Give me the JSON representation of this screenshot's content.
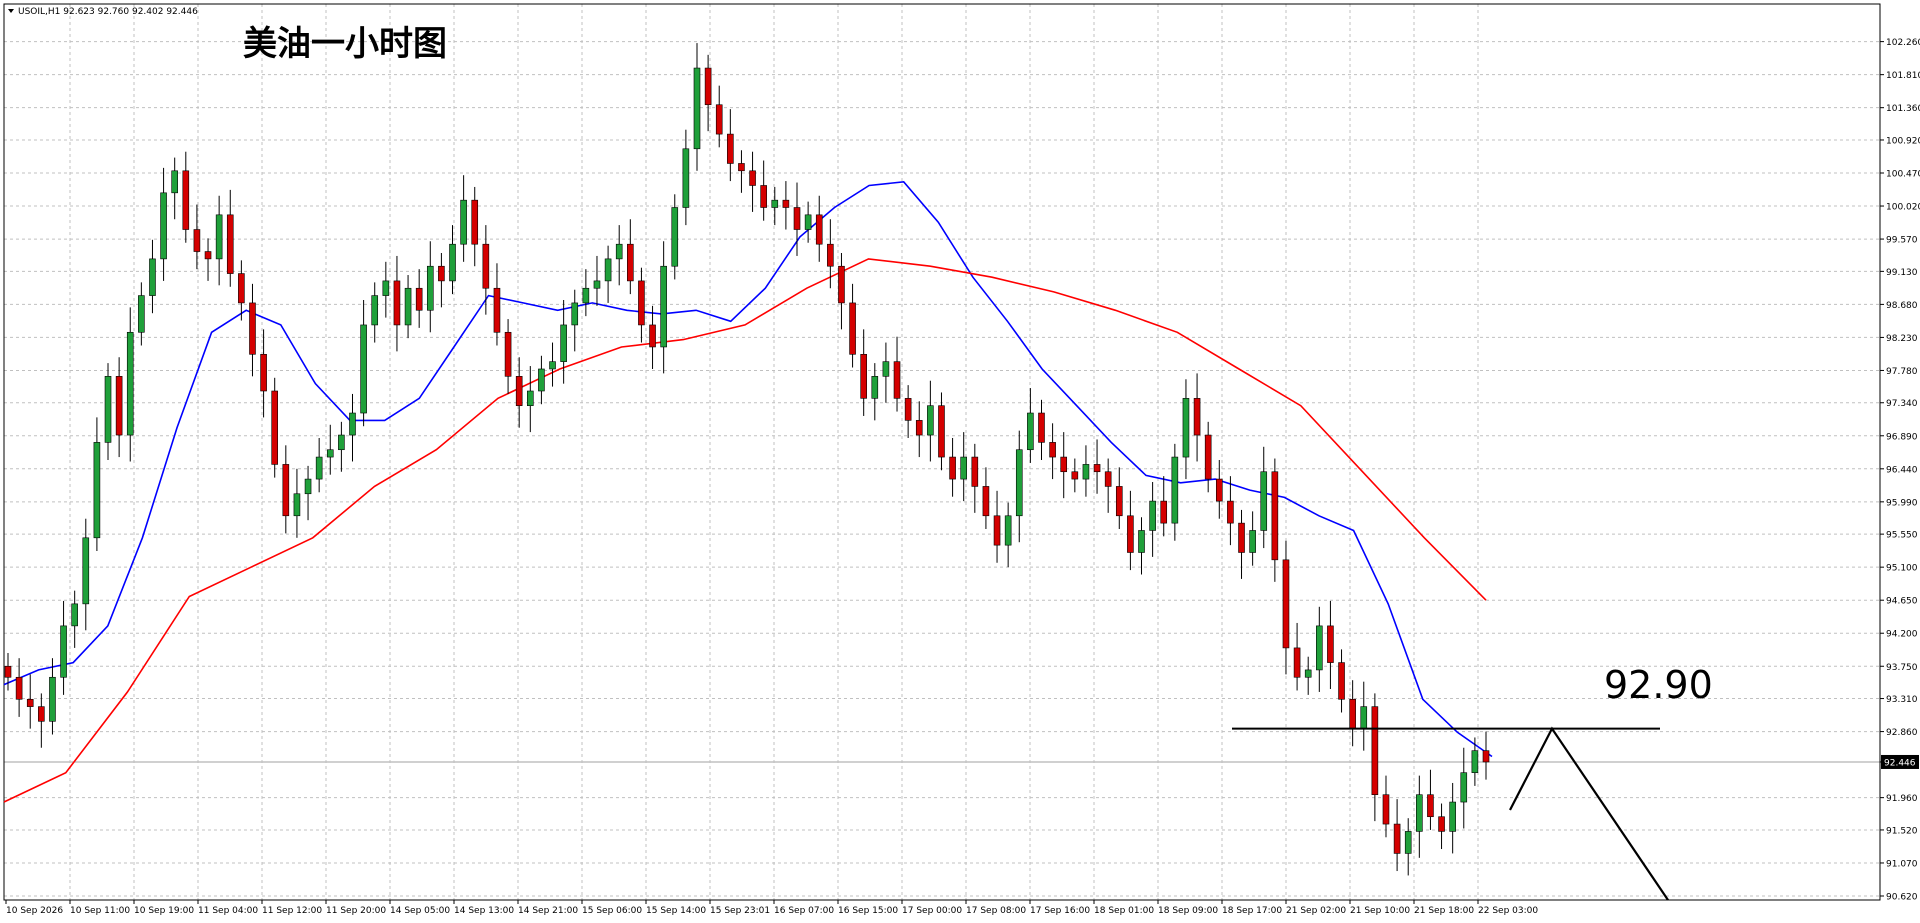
{
  "header": {
    "symbol_info": "USOIL,H1  92.623 92.760 92.402 92.446"
  },
  "annotations": {
    "title": "美油一小时图",
    "level_label": "92.90"
  },
  "chart_data": {
    "type": "candlestick",
    "title": "美油一小时图",
    "symbol": "USOIL",
    "timeframe": "H1",
    "ohlc_header": {
      "open": 92.623,
      "high": 92.76,
      "low": 92.402,
      "close": 92.446
    },
    "current_price": "92.446",
    "ylim": [
      90.62,
      102.5
    ],
    "y_ticks": [
      "102.260",
      "101.810",
      "101.360",
      "100.920",
      "100.470",
      "100.020",
      "99.570",
      "99.130",
      "98.680",
      "98.230",
      "97.780",
      "97.340",
      "96.890",
      "96.440",
      "95.990",
      "95.550",
      "95.100",
      "94.650",
      "94.200",
      "93.750",
      "93.310",
      "92.860",
      "92.446",
      "91.960",
      "91.520",
      "91.070",
      "90.620"
    ],
    "x_ticks": [
      "10 Sep 2026",
      "10 Sep 11:00",
      "10 Sep 19:00",
      "11 Sep 04:00",
      "11 Sep 12:00",
      "11 Sep 20:00",
      "14 Sep 05:00",
      "14 Sep 13:00",
      "14 Sep 21:00",
      "15 Sep 06:00",
      "15 Sep 14:00",
      "15 Sep 23:01",
      "16 Sep 07:00",
      "16 Sep 15:00",
      "17 Sep 00:00",
      "17 Sep 08:00",
      "17 Sep 16:00",
      "18 Sep 01:00",
      "18 Sep 09:00",
      "18 Sep 17:00",
      "21 Sep 02:00",
      "21 Sep 10:00",
      "21 Sep 18:00",
      "22 Sep 03:00"
    ],
    "close_path": [
      93.6,
      93.3,
      93.2,
      93.0,
      93.6,
      94.3,
      94.6,
      95.5,
      96.8,
      97.7,
      96.9,
      98.3,
      98.8,
      99.3,
      100.2,
      100.5,
      99.7,
      99.4,
      99.3,
      99.9,
      99.1,
      98.7,
      98.0,
      97.5,
      96.5,
      95.8,
      96.1,
      96.3,
      96.6,
      96.7,
      96.9,
      97.2,
      98.4,
      98.8,
      99.0,
      98.4,
      98.9,
      98.6,
      99.2,
      99.0,
      99.5,
      100.1,
      99.5,
      98.9,
      98.3,
      97.7,
      97.3,
      97.5,
      97.8,
      97.9,
      98.4,
      98.7,
      98.9,
      99.0,
      99.3,
      99.5,
      99.0,
      98.4,
      98.1,
      99.2,
      100.0,
      100.8,
      101.9,
      101.4,
      101.0,
      100.6,
      100.5,
      100.3,
      100.0,
      100.1,
      100.0,
      99.7,
      99.9,
      99.5,
      99.2,
      98.7,
      98.0,
      97.4,
      97.7,
      97.9,
      97.4,
      97.1,
      96.9,
      97.3,
      96.6,
      96.3,
      96.6,
      96.2,
      95.8,
      95.4,
      95.8,
      96.7,
      97.2,
      96.8,
      96.6,
      96.4,
      96.3,
      96.5,
      96.4,
      96.2,
      95.8,
      95.3,
      95.6,
      96.0,
      95.7,
      96.6,
      97.4,
      96.9,
      96.3,
      96.0,
      95.7,
      95.3,
      95.6,
      96.4,
      95.2,
      94.0,
      93.6,
      93.7,
      94.3,
      93.8,
      93.3,
      92.9,
      93.2,
      92.0,
      91.6,
      91.2,
      91.5,
      92.0,
      91.7,
      91.5,
      91.9,
      92.3,
      92.6,
      92.446
    ],
    "series": [
      {
        "name": "MA fast",
        "color": "#0000ff",
        "values": [
          93.5,
          93.7,
          93.8,
          94.3,
          95.5,
          97.0,
          98.3,
          98.6,
          98.4,
          97.6,
          97.1,
          97.1,
          97.4,
          98.1,
          98.8,
          98.7,
          98.6,
          98.7,
          98.6,
          98.55,
          98.6,
          98.45,
          98.9,
          99.6,
          100.0,
          100.3,
          100.35,
          99.8,
          99.05,
          98.45,
          97.8,
          97.3,
          96.8,
          96.35,
          96.25,
          96.3,
          96.15,
          96.05,
          95.8,
          95.6,
          94.6,
          93.3,
          92.85,
          92.52
        ]
      },
      {
        "name": "MA slow",
        "color": "#ff0000",
        "values": [
          91.9,
          92.3,
          93.4,
          94.7,
          95.1,
          95.5,
          96.2,
          96.7,
          97.4,
          97.8,
          98.1,
          98.2,
          98.4,
          98.9,
          99.3,
          99.2,
          99.05,
          98.85,
          98.6,
          98.3,
          97.8,
          97.3,
          96.4,
          95.5,
          94.65
        ]
      }
    ],
    "level_line": 92.9,
    "grid": true,
    "legend": "none"
  }
}
